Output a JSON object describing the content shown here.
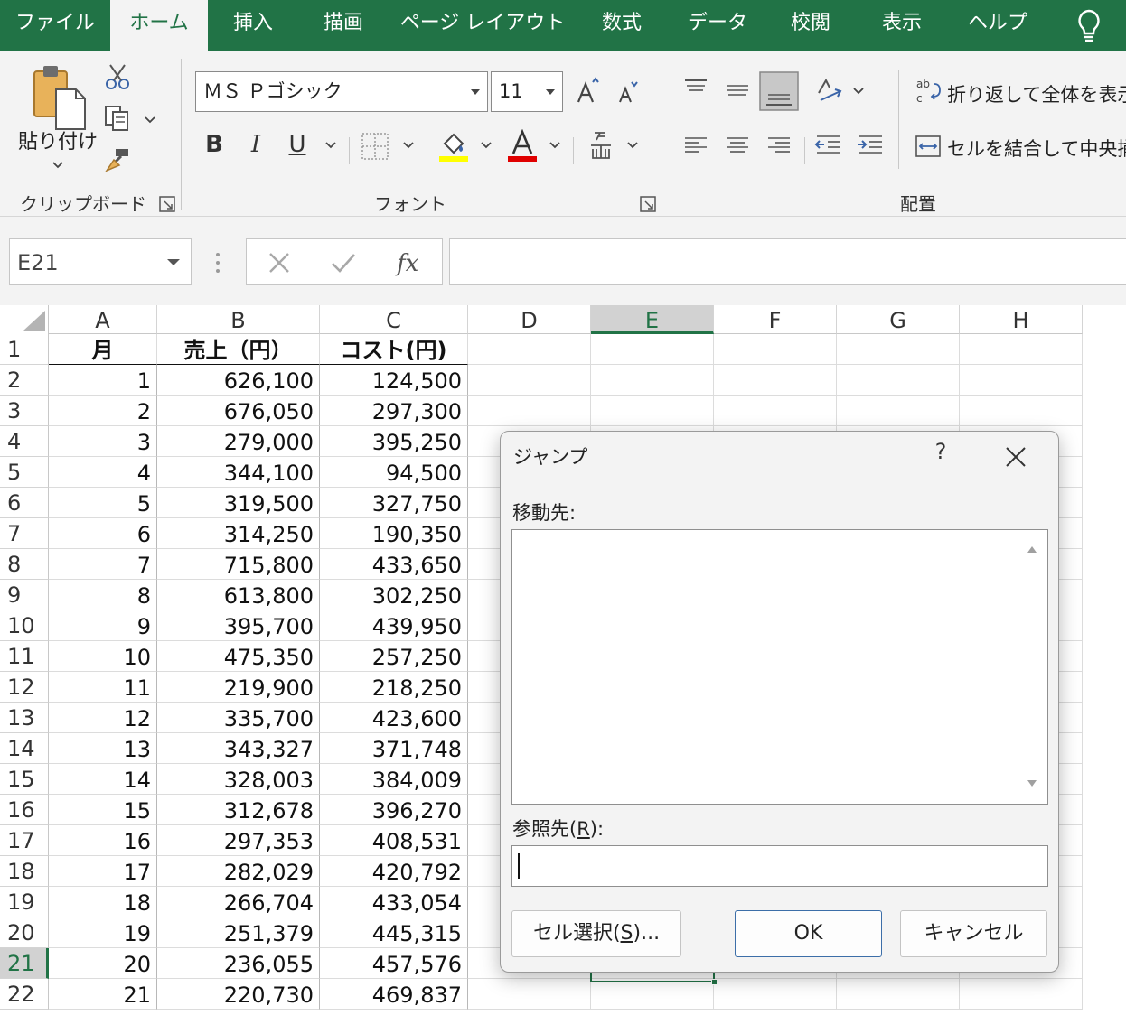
{
  "tabs": [
    {
      "label": "ファイル"
    },
    {
      "label": "ホーム"
    },
    {
      "label": "挿入"
    },
    {
      "label": "描画"
    },
    {
      "label": "ページ レイアウト"
    },
    {
      "label": "数式"
    },
    {
      "label": "データ"
    },
    {
      "label": "校閲"
    },
    {
      "label": "表示"
    },
    {
      "label": "ヘルプ"
    }
  ],
  "ribbon": {
    "clipboard": {
      "paste_label": "貼り付け",
      "group_label": "クリップボード"
    },
    "font": {
      "font_name": "ＭＳ Ｐゴシック",
      "font_size": "11",
      "bold": "B",
      "italic": "I",
      "underline": "U",
      "group_label": "フォント"
    },
    "alignment": {
      "wrap_text": "折り返して全体を表示",
      "merge_center": "セルを結合して中央揃え",
      "group_label": "配置"
    }
  },
  "formula_bar": {
    "name_box": "E21",
    "formula": ""
  },
  "grid": {
    "columns": [
      "A",
      "B",
      "C",
      "D",
      "E",
      "F",
      "G",
      "H"
    ],
    "selected_column": "E",
    "selected_row": 21,
    "header_row": [
      "月",
      "売上（円）",
      "コスト(円)"
    ],
    "rows": [
      {
        "n": 2,
        "a": "1",
        "b": "626,100",
        "c": "124,500"
      },
      {
        "n": 3,
        "a": "2",
        "b": "676,050",
        "c": "297,300"
      },
      {
        "n": 4,
        "a": "3",
        "b": "279,000",
        "c": "395,250"
      },
      {
        "n": 5,
        "a": "4",
        "b": "344,100",
        "c": "94,500"
      },
      {
        "n": 6,
        "a": "5",
        "b": "319,500",
        "c": "327,750"
      },
      {
        "n": 7,
        "a": "6",
        "b": "314,250",
        "c": "190,350"
      },
      {
        "n": 8,
        "a": "7",
        "b": "715,800",
        "c": "433,650"
      },
      {
        "n": 9,
        "a": "8",
        "b": "613,800",
        "c": "302,250"
      },
      {
        "n": 10,
        "a": "9",
        "b": "395,700",
        "c": "439,950"
      },
      {
        "n": 11,
        "a": "10",
        "b": "475,350",
        "c": "257,250"
      },
      {
        "n": 12,
        "a": "11",
        "b": "219,900",
        "c": "218,250"
      },
      {
        "n": 13,
        "a": "12",
        "b": "335,700",
        "c": "423,600"
      },
      {
        "n": 14,
        "a": "13",
        "b": "343,327",
        "c": "371,748"
      },
      {
        "n": 15,
        "a": "14",
        "b": "328,003",
        "c": "384,009"
      },
      {
        "n": 16,
        "a": "15",
        "b": "312,678",
        "c": "396,270"
      },
      {
        "n": 17,
        "a": "16",
        "b": "297,353",
        "c": "408,531"
      },
      {
        "n": 18,
        "a": "17",
        "b": "282,029",
        "c": "420,792"
      },
      {
        "n": 19,
        "a": "18",
        "b": "266,704",
        "c": "433,054"
      },
      {
        "n": 20,
        "a": "19",
        "b": "251,379",
        "c": "445,315"
      },
      {
        "n": 21,
        "a": "20",
        "b": "236,055",
        "c": "457,576"
      },
      {
        "n": 22,
        "a": "21",
        "b": "220,730",
        "c": "469,837"
      }
    ]
  },
  "dialog": {
    "title": "ジャンプ",
    "help": "?",
    "goto_label": "移動先:",
    "reference_label_pre": "参照先(",
    "reference_label_key": "R",
    "reference_label_post": "):",
    "reference_value": "",
    "special_pre": "セル選択(",
    "special_key": "S",
    "special_post": ")...",
    "ok": "OK",
    "cancel": "キャンセル"
  },
  "colors": {
    "accent": "#217346",
    "fill_highlight": "#ffff00",
    "font_color": "#e00000"
  }
}
